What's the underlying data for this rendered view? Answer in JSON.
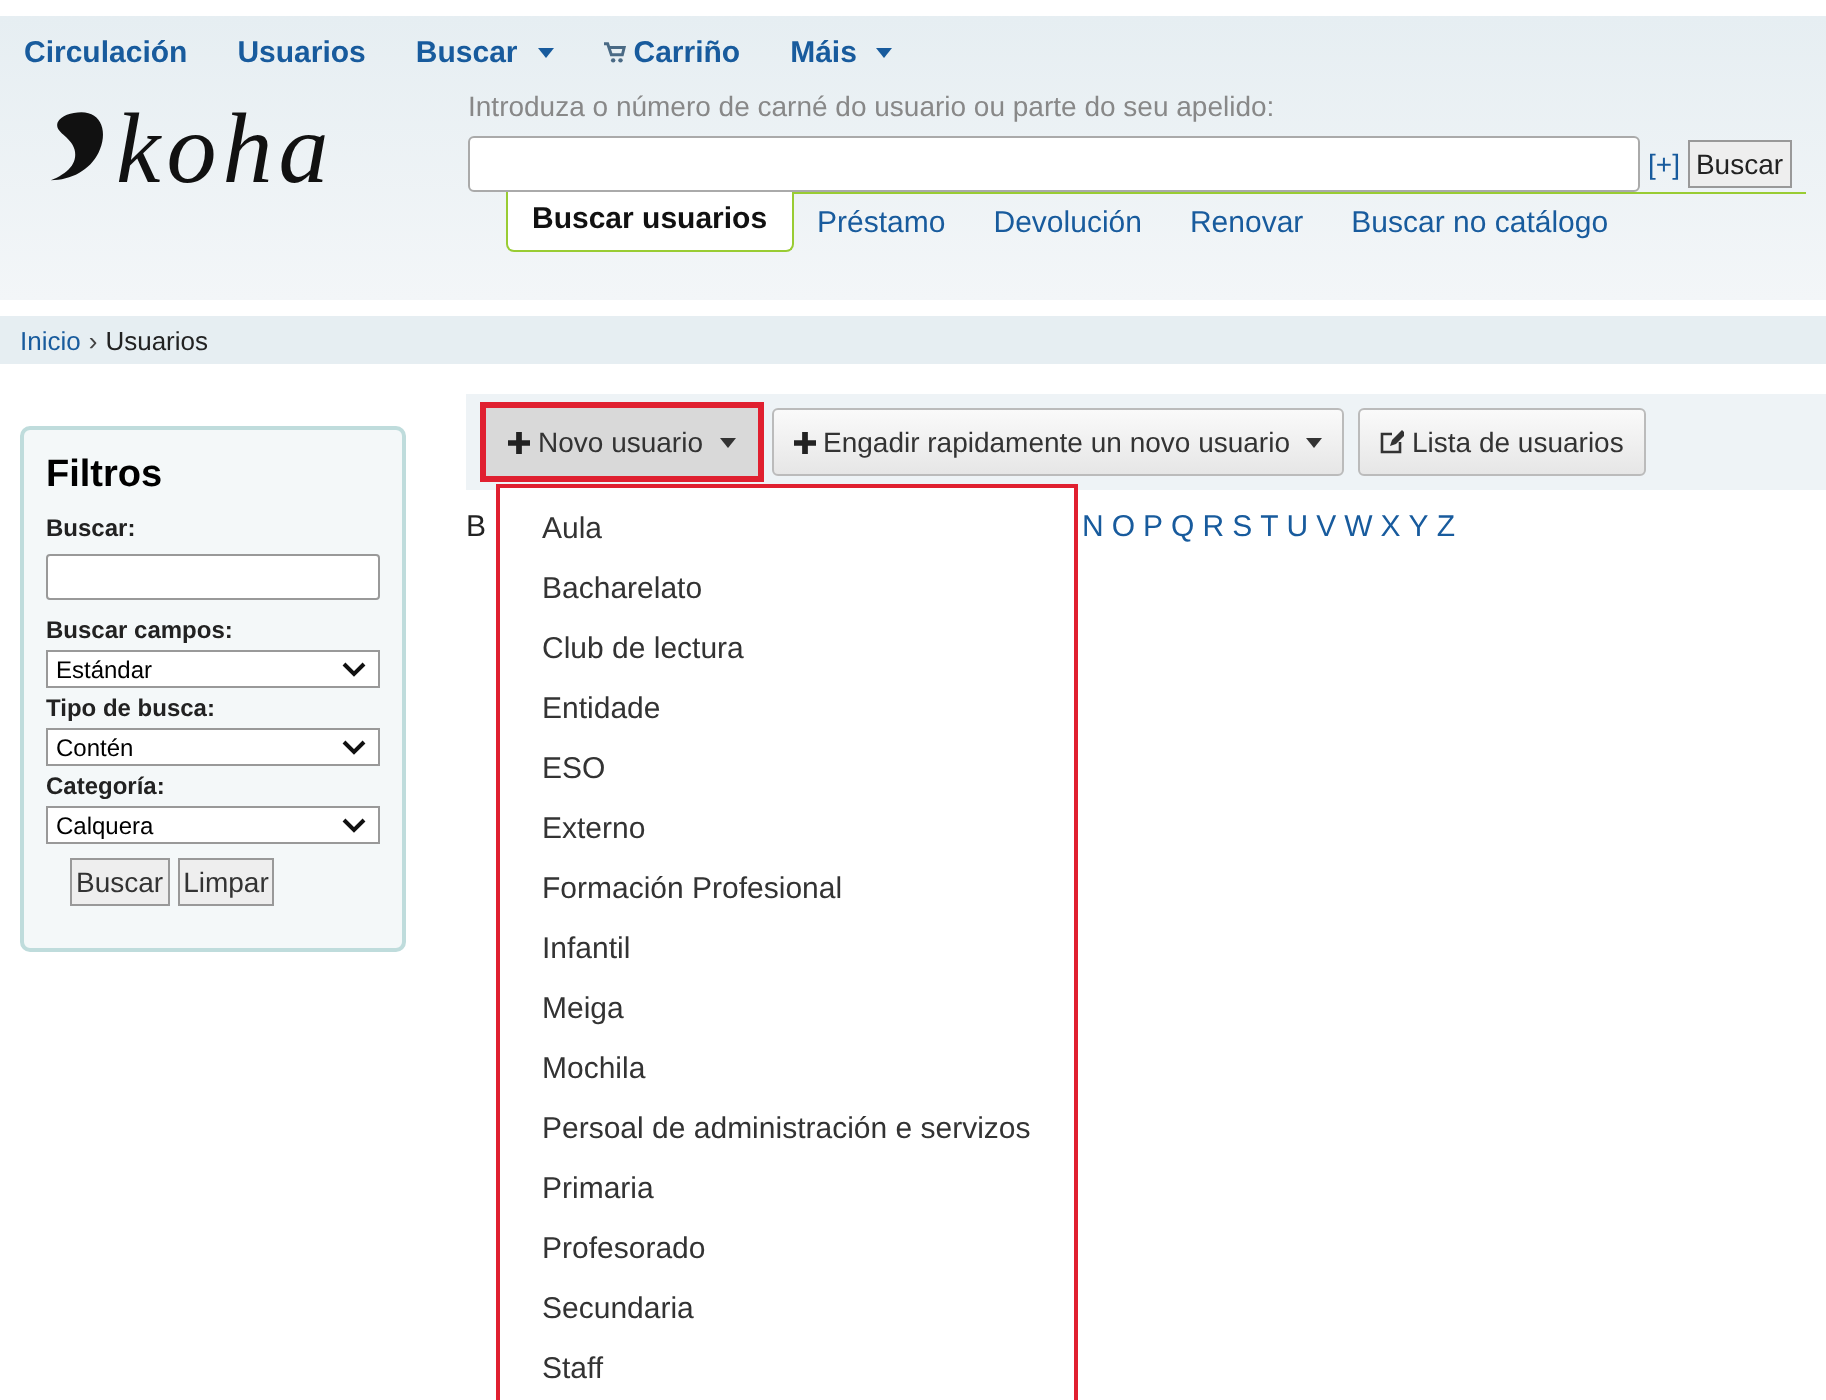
{
  "top_menu": [
    {
      "label": "Circulación",
      "caret": false,
      "kind": "link"
    },
    {
      "label": "Usuarios",
      "caret": false,
      "kind": "link"
    },
    {
      "label": "Buscar",
      "caret": true,
      "kind": "link"
    },
    {
      "label": "Carriño",
      "caret": false,
      "kind": "cart"
    },
    {
      "label": "Máis",
      "caret": true,
      "kind": "link"
    }
  ],
  "logo": "koha",
  "search": {
    "label": "Introduza o número de carné do usuario ou parte do seu apelido:",
    "more": "[+]",
    "button": "Buscar"
  },
  "search_tabs": [
    {
      "label": "Buscar usuarios",
      "selected": true
    },
    {
      "label": "Préstamo",
      "selected": false
    },
    {
      "label": "Devolución",
      "selected": false
    },
    {
      "label": "Renovar",
      "selected": false
    },
    {
      "label": "Buscar no catálogo",
      "selected": false
    }
  ],
  "breadcrumb": {
    "link": "Inicio",
    "separator": "›",
    "current": "Usuarios"
  },
  "filters": {
    "title": "Filtros",
    "search_label": "Buscar:",
    "fields": [
      {
        "label": "Buscar campos:",
        "value": "Estándar"
      },
      {
        "label": "Tipo de busca:",
        "value": "Contén"
      },
      {
        "label": "Categoría:",
        "value": "Calquera"
      }
    ],
    "buttons": [
      "Buscar",
      "Limpar"
    ]
  },
  "toolbar": [
    {
      "label": "Novo usuario",
      "kind": "add",
      "caret": true,
      "highlighted": true
    },
    {
      "label": "Engadir rapidamente un novo usuario",
      "kind": "add",
      "caret": true,
      "highlighted": false
    },
    {
      "label": "Lista de usuarios",
      "kind": "list",
      "caret": false,
      "highlighted": false
    }
  ],
  "browse": {
    "label": "B",
    "letters": [
      "N",
      "O",
      "P",
      "Q",
      "R",
      "S",
      "T",
      "U",
      "V",
      "W",
      "X",
      "Y",
      "Z"
    ]
  },
  "dropdown": {
    "highlighted": true,
    "items": [
      "Aula",
      "Bacharelato",
      "Club de lectura",
      "Entidade",
      "ESO",
      "Externo",
      "Formación Profesional",
      "Infantil",
      "Meiga",
      "Mochila",
      "Persoal de administración e servizos",
      "Primaria",
      "Profesorado",
      "Secundaria",
      "Staff"
    ]
  }
}
